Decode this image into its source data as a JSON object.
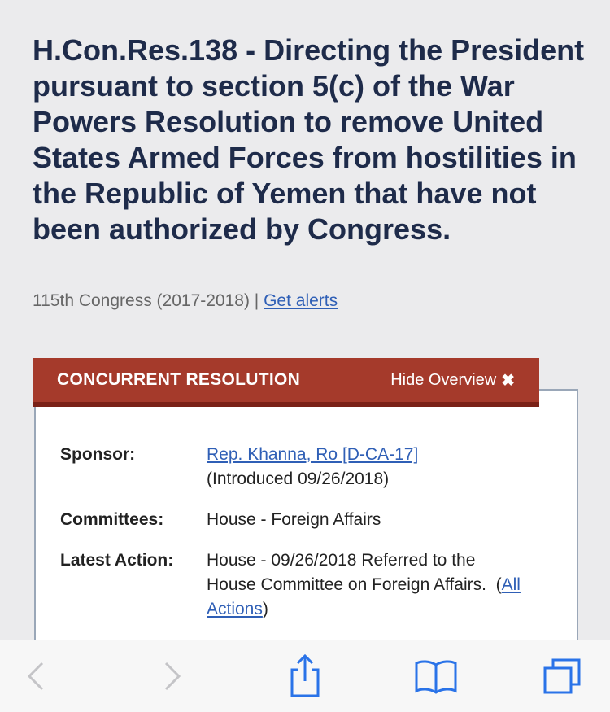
{
  "bill": {
    "title": "H.Con.Res.138 - Directing the President pursuant to section 5(c) of the War Powers Resolution to remove United States Armed Forces from hostilities in the Republic of Yemen that have not been authorized by Congress.",
    "congress": "115th Congress (2017-2018) |",
    "alerts_link": "Get alerts"
  },
  "overview": {
    "type_label": "CONCURRENT RESOLUTION",
    "toggle_label": "Hide Overview",
    "sponsor_label": "Sponsor:",
    "sponsor_link": "Rep. Khanna, Ro [D-CA-17]",
    "introduced": "(Introduced 09/26/2018)",
    "committees_label": "Committees:",
    "committees_value": "House - Foreign Affairs",
    "latest_action_label": "Latest Action:",
    "latest_action_text": "House - 09/26/2018 Referred to the House Committee on Foreign Affairs.",
    "all_actions_link": "All Actions"
  },
  "toolbar": {
    "icons": [
      "back-icon",
      "forward-icon",
      "share-icon",
      "bookmarks-icon",
      "tabs-icon"
    ]
  },
  "colors": {
    "banner": "#a53a2b",
    "link": "#2f5fb6",
    "title": "#1e2b4a"
  }
}
